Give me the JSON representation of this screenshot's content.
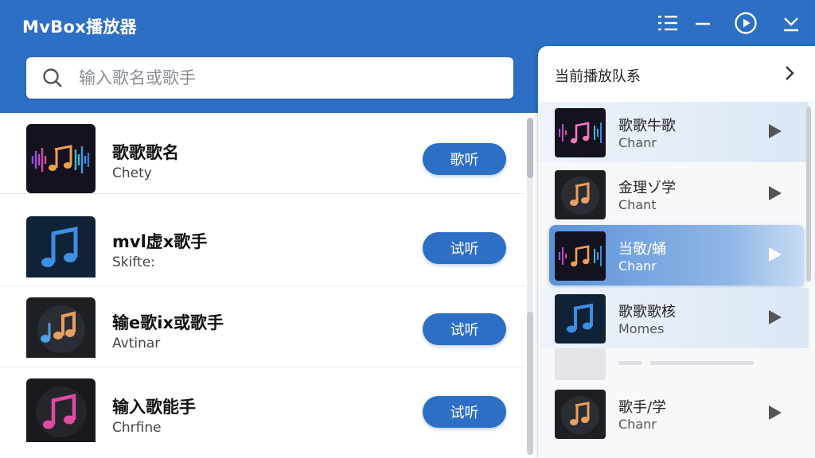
{
  "app": {
    "title": "MvBox播放器"
  },
  "window_controls": [
    "list-icon",
    "minimize-icon",
    "play-circle-icon",
    "download-icon"
  ],
  "search": {
    "placeholder": "输入歌名或歌手",
    "value": ""
  },
  "songs": [
    {
      "title": "歌歌歌名",
      "artist": "Chety",
      "button": "歌听",
      "cover": "waveform"
    },
    {
      "title": "mvl虚x歌手",
      "artist": "Skifte:",
      "button": "试听",
      "cover": "blue-note"
    },
    {
      "title": "输e歌ix或歌手",
      "artist": "Avtinar",
      "button": "试听",
      "cover": "color-notes"
    },
    {
      "title": "输入歌能手",
      "artist": "Chrfine",
      "button": "试听",
      "cover": "pink-note"
    }
  ],
  "queue": {
    "title": "当前播放队系",
    "items": [
      {
        "title": "歌歌牛歌",
        "sub": "Chanr",
        "cover": "waveform",
        "state": "light"
      },
      {
        "title": "金理ゾ学",
        "sub": "Chant",
        "cover": "orange-note",
        "state": "normal"
      },
      {
        "title": "当敬/蛹",
        "sub": "Chanr",
        "cover": "waveform",
        "state": "active"
      },
      {
        "title": "歌歌歌核",
        "sub": "Momes",
        "cover": "blue-note",
        "state": "light"
      },
      {
        "title": "歌手/学",
        "sub": "Chanr",
        "cover": "orange-note",
        "state": "normal"
      }
    ]
  },
  "colors": {
    "brand": "#2d6fc4",
    "active_gradient_start": "#5b92d8"
  }
}
